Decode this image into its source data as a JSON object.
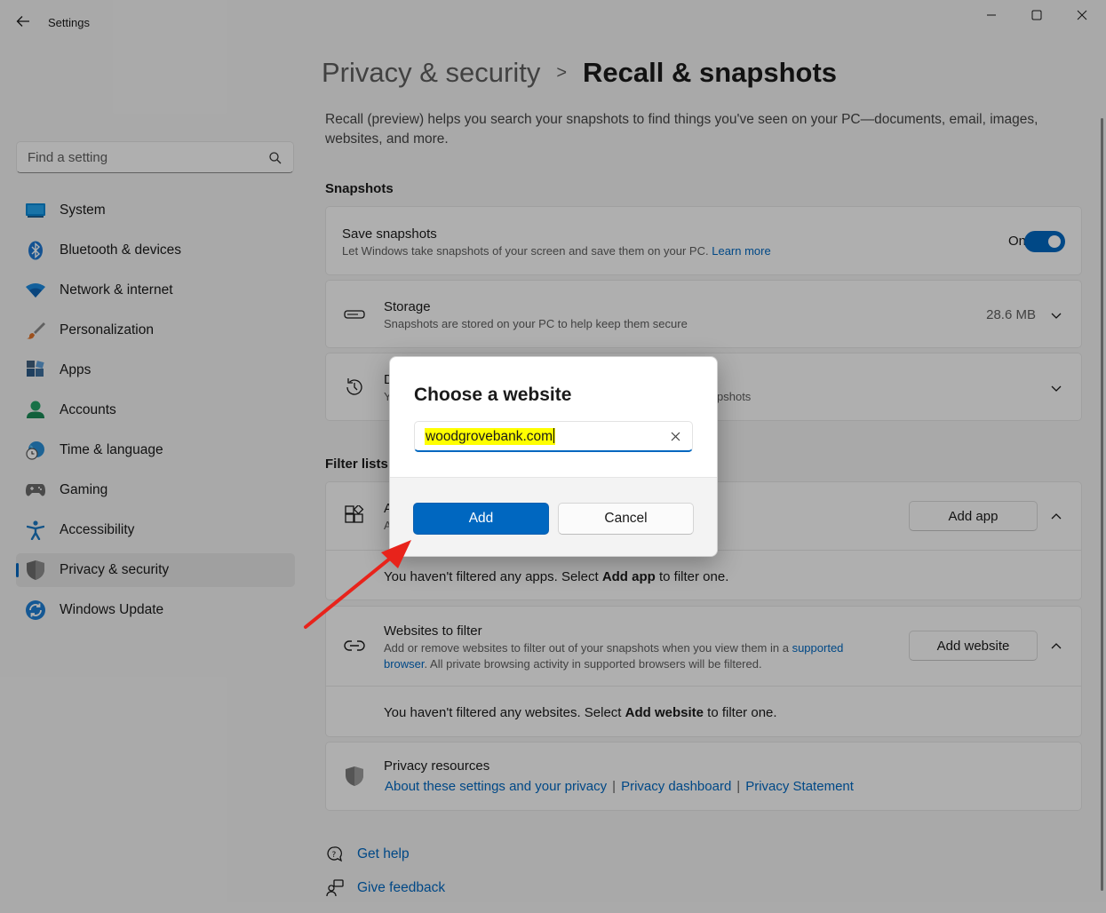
{
  "window": {
    "app_title": "Settings"
  },
  "sidebar": {
    "search_placeholder": "Find a setting",
    "items": [
      {
        "label": "System",
        "icon": "monitor-icon"
      },
      {
        "label": "Bluetooth & devices",
        "icon": "bluetooth-icon"
      },
      {
        "label": "Network & internet",
        "icon": "wifi-icon"
      },
      {
        "label": "Personalization",
        "icon": "brush-icon"
      },
      {
        "label": "Apps",
        "icon": "apps-icon"
      },
      {
        "label": "Accounts",
        "icon": "person-icon"
      },
      {
        "label": "Time & language",
        "icon": "globe-clock-icon"
      },
      {
        "label": "Gaming",
        "icon": "gamepad-icon"
      },
      {
        "label": "Accessibility",
        "icon": "accessibility-icon"
      },
      {
        "label": "Privacy & security",
        "icon": "shield-icon",
        "active": true
      },
      {
        "label": "Windows Update",
        "icon": "update-icon"
      }
    ]
  },
  "main": {
    "breadcrumb_parent": "Privacy & security",
    "breadcrumb_separator": ">",
    "breadcrumb_current": "Recall & snapshots",
    "intro": "Recall (preview) helps you search your snapshots to find things you've seen on your PC—documents, email, images, websites, and more.",
    "snapshots_section": "Snapshots",
    "save_snapshots": {
      "title": "Save snapshots",
      "desc": "Let Windows take snapshots of your screen and save them on your PC.",
      "link": "Learn more",
      "toggle_label": "On",
      "toggle_on": true
    },
    "storage": {
      "title": "Storage",
      "desc": "Snapshots are stored on your PC to help keep them secure",
      "value": "28.6 MB"
    },
    "delete_card": {
      "title_partial": "D",
      "desc_partial_left": "Y",
      "desc_partial_right": "pshots"
    },
    "filter_section": "Filter lists",
    "apps_filter": {
      "title_partial": "A",
      "desc_partial": "A",
      "button": "Add app",
      "empty_prefix": "You haven't filtered any apps. Select ",
      "empty_bold": "Add app",
      "empty_suffix": " to filter one."
    },
    "websites_filter": {
      "title": "Websites to filter",
      "desc_part1": "Add or remove websites to filter out of your snapshots when you view them in a ",
      "desc_link1": "supported",
      "desc_link2": "browser",
      "desc_part2": ". All private browsing activity in supported browsers will be filtered.",
      "button": "Add website",
      "empty_prefix": "You haven't filtered any websites. Select ",
      "empty_bold": "Add website",
      "empty_suffix": " to filter one."
    },
    "privacy_resources": {
      "title": "Privacy resources",
      "links": [
        "About these settings and your privacy",
        "Privacy dashboard",
        "Privacy Statement"
      ],
      "separator": "|"
    },
    "footer": {
      "get_help": "Get help",
      "give_feedback": "Give feedback"
    }
  },
  "dialog": {
    "title": "Choose a website",
    "input_value": "woodgrovebank.com",
    "primary_button": "Add",
    "secondary_button": "Cancel"
  },
  "colors": {
    "accent": "#0067c0",
    "arrow": "#e8231b",
    "highlight": "#ffff00"
  }
}
